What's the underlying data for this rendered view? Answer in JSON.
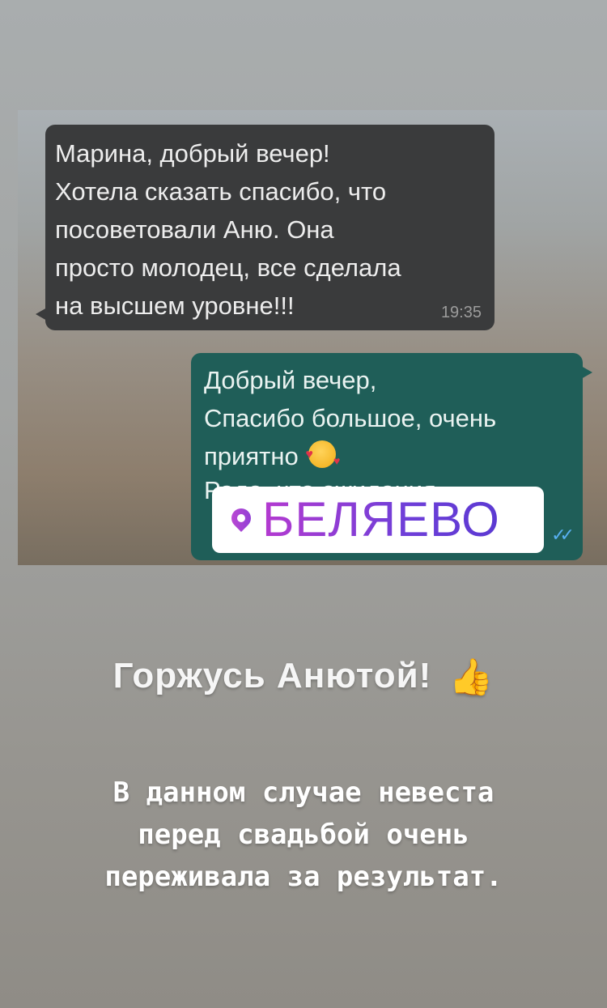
{
  "chat": {
    "incoming": {
      "lines": [
        "Марина, добрый вечер!",
        "Хотела сказать спасибо, что",
        "посоветовали Аню. Она",
        "просто молодец, все сделала",
        "на высшем уровне!!!"
      ],
      "time": "19:35"
    },
    "outgoing": {
      "lines": [
        "Добрый вечер,",
        "Спасибо большое, очень",
        "приятно"
      ],
      "partial_line": "Рада, что ожидания"
    }
  },
  "sticker": {
    "location": "БЕЛЯЕВО",
    "icon": "location-pin-icon"
  },
  "captions": {
    "headline": "Горжусь Анютой!",
    "headline_icon": "thumbs-up-icon",
    "body_lines": [
      "В данном случае невеста",
      "перед свадьбой очень",
      "переживала за результат."
    ]
  },
  "colors": {
    "incoming_bubble": "#3a3b3c",
    "outgoing_bubble": "#1f5e58",
    "sticker_gradient_start": "#b43ad0",
    "sticker_gradient_end": "#5b39d2",
    "read_ticks": "#58b0f2"
  }
}
